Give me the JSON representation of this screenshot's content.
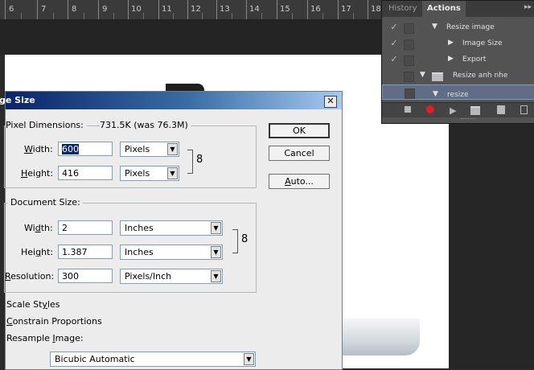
{
  "ruler": {
    "numbers": [
      "6",
      "7",
      "8",
      "9",
      "10",
      "11",
      "12",
      "13",
      "14",
      "15",
      "16",
      "17",
      "18"
    ]
  },
  "panel": {
    "tabs": [
      "History",
      "Actions"
    ],
    "menu_icon": "panel-menu-icon",
    "actions": [
      {
        "check": "✓",
        "toggle": "▼",
        "label": "Resize image"
      },
      {
        "check": "✓",
        "toggle": "▶",
        "label": "Image Size"
      },
      {
        "check": "✓",
        "toggle": "▶",
        "label": "Export"
      },
      {
        "check": "",
        "toggle": "▼",
        "label": "Resize anh nhe"
      },
      {
        "check": "",
        "toggle": "▼",
        "label": "resize"
      }
    ],
    "bottom_icons": [
      "stop-icon",
      "record-icon",
      "play-icon",
      "new-set-icon",
      "new-action-icon",
      "delete-icon"
    ],
    "colors": {
      "record": "#e02020",
      "selected_row": "#5f6e85"
    }
  },
  "dialog": {
    "title": "ge Size",
    "close_label": "✕",
    "pixel_dimensions": {
      "label": "Pixel Dimensions:",
      "value": "731.5K (was 76.3M)"
    },
    "width": {
      "label": "Width:",
      "value": "600",
      "unit": "Pixels"
    },
    "height": {
      "label": "Height:",
      "value": "416",
      "unit": "Pixels"
    },
    "document_size": {
      "label": "Document Size:",
      "width": {
        "label": "Width:",
        "value": "2",
        "unit": "Inches"
      },
      "height": {
        "label": "Height:",
        "value": "1.387",
        "unit": "Inches"
      },
      "resolution": {
        "label": "Resolution:",
        "value": "300",
        "unit": "Pixels/Inch"
      }
    },
    "options": {
      "scale_styles": "Scale Styles",
      "constrain_proportions": "Constrain Proportions",
      "resample_image": "Resample Image:",
      "resample_method": "Bicubic Automatic"
    },
    "buttons": {
      "ok": "OK",
      "cancel": "Cancel",
      "auto": "Auto..."
    }
  }
}
